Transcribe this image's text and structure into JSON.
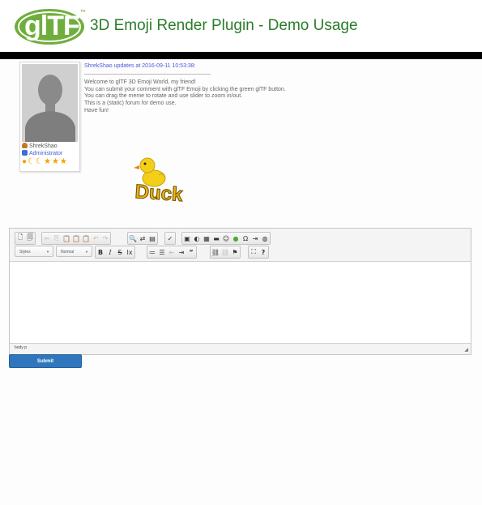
{
  "header": {
    "logo_text": "glTF",
    "logo_tm": "™",
    "title": "3D Emoji Render Plugin - Demo Usage"
  },
  "user": {
    "name": "ShrekShao",
    "role": "Administrator",
    "rank_icons": [
      "sun-icon",
      "moon-icon",
      "moon-icon",
      "star-icon",
      "star-icon",
      "star-icon"
    ]
  },
  "post": {
    "header": "ShrekShao updates at 2016-09-11 10:53:38:",
    "lines": [
      "Welcome to glTF 3D Emoji World, my friend!",
      "You can submit your comment with glTF Emoji by clicking the green glTF button.",
      "You can drag the meme to rotate and use slider to zoom in/out.",
      "This is a (static) forum for demo use.",
      "Have fun!"
    ]
  },
  "emoji": {
    "label": "Duck"
  },
  "editor": {
    "styles_label": "Styles",
    "format_label": "Normal",
    "path_label": "body  p",
    "toolbar1_groups": [
      [
        "new-page",
        "preview"
      ],
      [
        "cut",
        "copy",
        "paste",
        "paste-text",
        "paste-word",
        "undo",
        "redo"
      ],
      [
        "find",
        "replace",
        "select-all",
        "spellcheck"
      ],
      [
        "image",
        "flash",
        "table",
        "horizontal-rule",
        "smiley",
        "gltf-emoji",
        "special-char",
        "page-break",
        "iframe"
      ]
    ],
    "toolbar2_groups": [
      [
        "bold",
        "italic",
        "strike",
        "remove-format"
      ],
      [
        "numbered-list",
        "bulleted-list",
        "outdent",
        "indent",
        "blockquote"
      ],
      [
        "link",
        "unlink",
        "anchor"
      ],
      [
        "maximize",
        "about"
      ]
    ]
  },
  "submit_label": "Submit",
  "colors": {
    "title_green": "#2a7d2a",
    "logo_green": "#6fae3c",
    "link_blue": "#4a5bd8",
    "submit_blue": "#2f76bd",
    "duck_yellow": "#f4cf1a"
  }
}
